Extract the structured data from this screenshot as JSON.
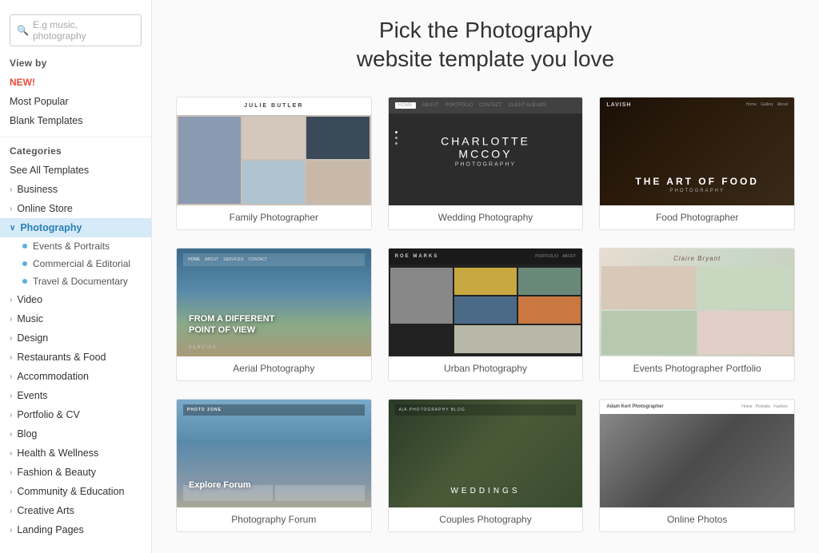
{
  "search": {
    "placeholder": "E.g music, photography"
  },
  "sidebar": {
    "view_by_label": "View by",
    "view_items": [
      {
        "id": "new",
        "label": "NEW!",
        "special": "new"
      },
      {
        "id": "most-popular",
        "label": "Most Popular"
      },
      {
        "id": "blank-templates",
        "label": "Blank Templates"
      }
    ],
    "categories_label": "Categories",
    "see_all": "See All Templates",
    "categories": [
      {
        "id": "business",
        "label": "Business",
        "expanded": false
      },
      {
        "id": "online-store",
        "label": "Online Store",
        "expanded": false
      },
      {
        "id": "photography",
        "label": "Photography",
        "expanded": true,
        "active": true
      },
      {
        "id": "video",
        "label": "Video",
        "expanded": false
      },
      {
        "id": "music",
        "label": "Music",
        "expanded": false
      },
      {
        "id": "design",
        "label": "Design",
        "expanded": false
      },
      {
        "id": "restaurants",
        "label": "Restaurants & Food",
        "expanded": false
      },
      {
        "id": "accommodation",
        "label": "Accommodation",
        "expanded": false
      },
      {
        "id": "events",
        "label": "Events",
        "expanded": false
      },
      {
        "id": "portfolio",
        "label": "Portfolio & CV",
        "expanded": false
      },
      {
        "id": "blog",
        "label": "Blog",
        "expanded": false
      },
      {
        "id": "health",
        "label": "Health & Wellness",
        "expanded": false
      },
      {
        "id": "fashion",
        "label": "Fashion & Beauty",
        "expanded": false
      },
      {
        "id": "community",
        "label": "Community & Education",
        "expanded": false
      },
      {
        "id": "creative",
        "label": "Creative Arts",
        "expanded": false
      },
      {
        "id": "landing",
        "label": "Landing Pages",
        "expanded": false
      }
    ],
    "photography_subs": [
      {
        "id": "events-portraits",
        "label": "Events & Portraits"
      },
      {
        "id": "commercial",
        "label": "Commercial & Editorial"
      },
      {
        "id": "travel",
        "label": "Travel & Documentary"
      }
    ]
  },
  "main": {
    "title_line1": "Pick the Photography",
    "title_line2": "website template you love",
    "templates": [
      {
        "id": "family",
        "label": "Family Photographer",
        "thumb_type": "family",
        "thumb_text": ""
      },
      {
        "id": "wedding",
        "label": "Wedding Photography",
        "thumb_type": "wedding",
        "thumb_text": "Charlotte McCoy"
      },
      {
        "id": "food",
        "label": "Food Photographer",
        "thumb_type": "food",
        "thumb_text": "The Art of Food"
      },
      {
        "id": "aerial",
        "label": "Aerial Photography",
        "thumb_type": "aerial",
        "thumb_text": "From a Different Point of View"
      },
      {
        "id": "urban",
        "label": "Urban Photography",
        "thumb_type": "urban",
        "thumb_text": ""
      },
      {
        "id": "events-portfolio",
        "label": "Events Photographer Portfolio",
        "thumb_type": "events",
        "thumb_text": "Claire Bryant"
      },
      {
        "id": "forum",
        "label": "Photography Forum",
        "thumb_type": "forum",
        "thumb_text": "Explore Forum"
      },
      {
        "id": "couples",
        "label": "Couples Photography",
        "thumb_type": "couples",
        "thumb_text": "Weddings"
      },
      {
        "id": "online",
        "label": "Online Photos",
        "thumb_type": "online",
        "thumb_text": ""
      }
    ]
  }
}
